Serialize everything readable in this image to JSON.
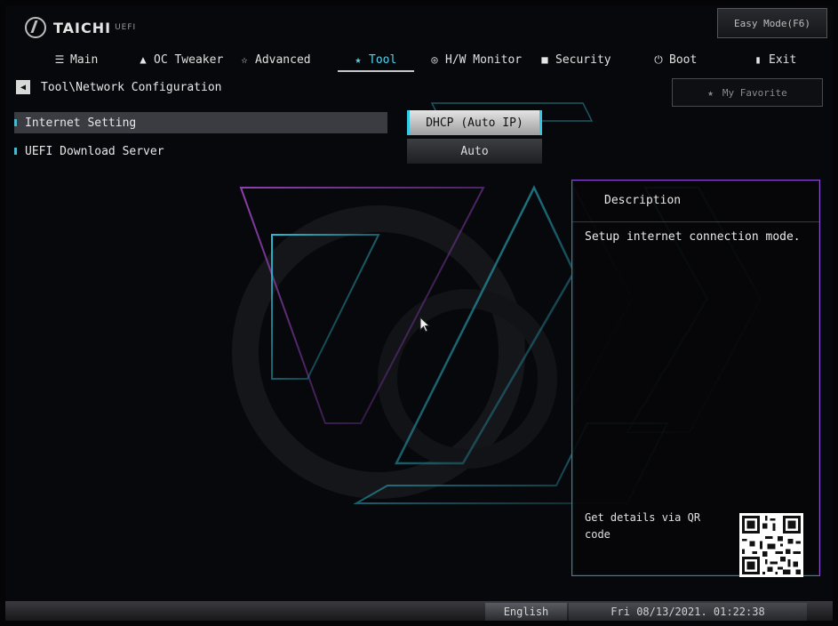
{
  "header": {
    "brand": "TAICHI",
    "brand_sub": "UEFI",
    "easy_mode_label": "Easy Mode(F6)"
  },
  "tabs": [
    {
      "label": "Main",
      "icon": "list-icon",
      "active": false
    },
    {
      "label": "OC Tweaker",
      "icon": "flame-icon",
      "active": false
    },
    {
      "label": "Advanced",
      "icon": "star-outline-icon",
      "active": false
    },
    {
      "label": "Tool",
      "icon": "tool-star-icon",
      "active": true
    },
    {
      "label": "H/W Monitor",
      "icon": "monitor-icon",
      "active": false
    },
    {
      "label": "Security",
      "icon": "shield-icon",
      "active": false
    },
    {
      "label": "Boot",
      "icon": "power-icon",
      "active": false
    },
    {
      "label": "Exit",
      "icon": "exit-door-icon",
      "active": false
    }
  ],
  "breadcrumb": "Tool\\Network Configuration",
  "favorite_label": "My Favorite",
  "settings": [
    {
      "label": "Internet Setting",
      "value": "DHCP (Auto IP)",
      "selected": true
    },
    {
      "label": "UEFI Download Server",
      "value": "Auto",
      "selected": false
    }
  ],
  "description": {
    "title": "Description",
    "text": "Setup internet connection mode.",
    "qr_text": "Get details via QR code"
  },
  "footer": {
    "language": "English",
    "datetime": "Fri 08/13/2021. 01:22:38"
  },
  "colors": {
    "accent_cyan": "#33c9e6",
    "accent_purple": "#8a4fd0",
    "background": "#07080b"
  }
}
